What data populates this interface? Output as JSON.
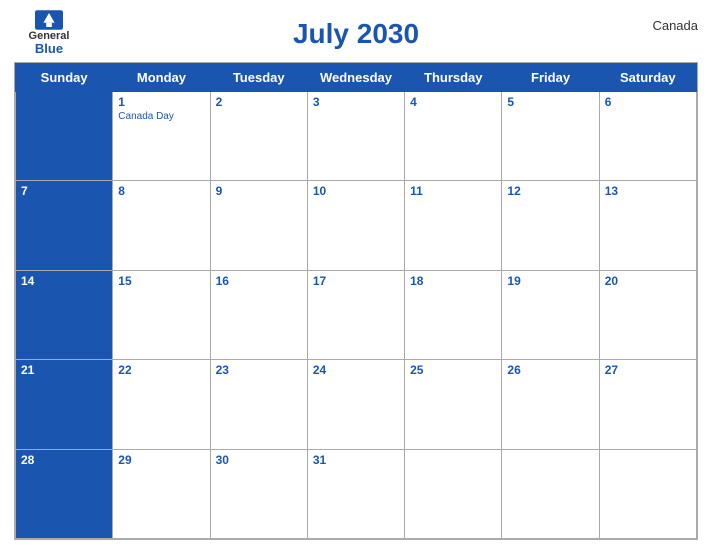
{
  "header": {
    "logo_general": "General",
    "logo_blue": "Blue",
    "title": "July 2030",
    "country": "Canada"
  },
  "weekdays": [
    "Sunday",
    "Monday",
    "Tuesday",
    "Wednesday",
    "Thursday",
    "Friday",
    "Saturday"
  ],
  "weeks": [
    [
      {
        "day": "",
        "header": true
      },
      {
        "day": "1",
        "holiday": "Canada Day",
        "header": true
      },
      {
        "day": "2",
        "header": true
      },
      {
        "day": "3",
        "header": true
      },
      {
        "day": "4",
        "header": true
      },
      {
        "day": "5",
        "header": true
      },
      {
        "day": "6",
        "header": true
      }
    ],
    [
      {
        "day": "7"
      },
      {
        "day": "8"
      },
      {
        "day": "9"
      },
      {
        "day": "10"
      },
      {
        "day": "11"
      },
      {
        "day": "12"
      },
      {
        "day": "13"
      }
    ],
    [
      {
        "day": "14"
      },
      {
        "day": "15"
      },
      {
        "day": "16"
      },
      {
        "day": "17"
      },
      {
        "day": "18"
      },
      {
        "day": "19"
      },
      {
        "day": "20"
      }
    ],
    [
      {
        "day": "21"
      },
      {
        "day": "22"
      },
      {
        "day": "23"
      },
      {
        "day": "24"
      },
      {
        "day": "25"
      },
      {
        "day": "26"
      },
      {
        "day": "27"
      }
    ],
    [
      {
        "day": "28"
      },
      {
        "day": "29"
      },
      {
        "day": "30"
      },
      {
        "day": "31"
      },
      {
        "day": ""
      },
      {
        "day": ""
      },
      {
        "day": ""
      }
    ]
  ],
  "colors": {
    "header_bg": "#1a56b0",
    "text_blue": "#1a56b0"
  }
}
